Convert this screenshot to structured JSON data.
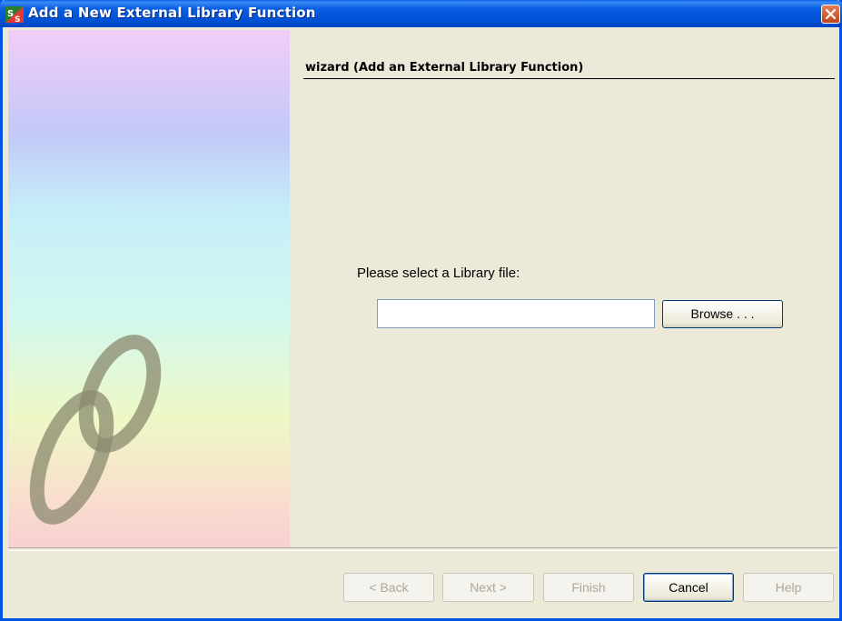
{
  "window": {
    "title": "Add a New External Library Function",
    "icon": "ss-app-icon",
    "close_icon": "close-icon"
  },
  "side_panel": {
    "logo": "script-ss-logo"
  },
  "content": {
    "title": "wizard (Add an External Library Function)",
    "prompt": "Please select a Library file:",
    "file_value": "",
    "browse_label": "Browse . . ."
  },
  "footer": {
    "back_label": "< Back",
    "next_label": "Next >",
    "finish_label": "Finish",
    "cancel_label": "Cancel",
    "help_label": "Help"
  },
  "colors": {
    "titlebar": "#0054e3",
    "dialog_bg": "#ece9d8",
    "close_button": "#c4421d"
  }
}
